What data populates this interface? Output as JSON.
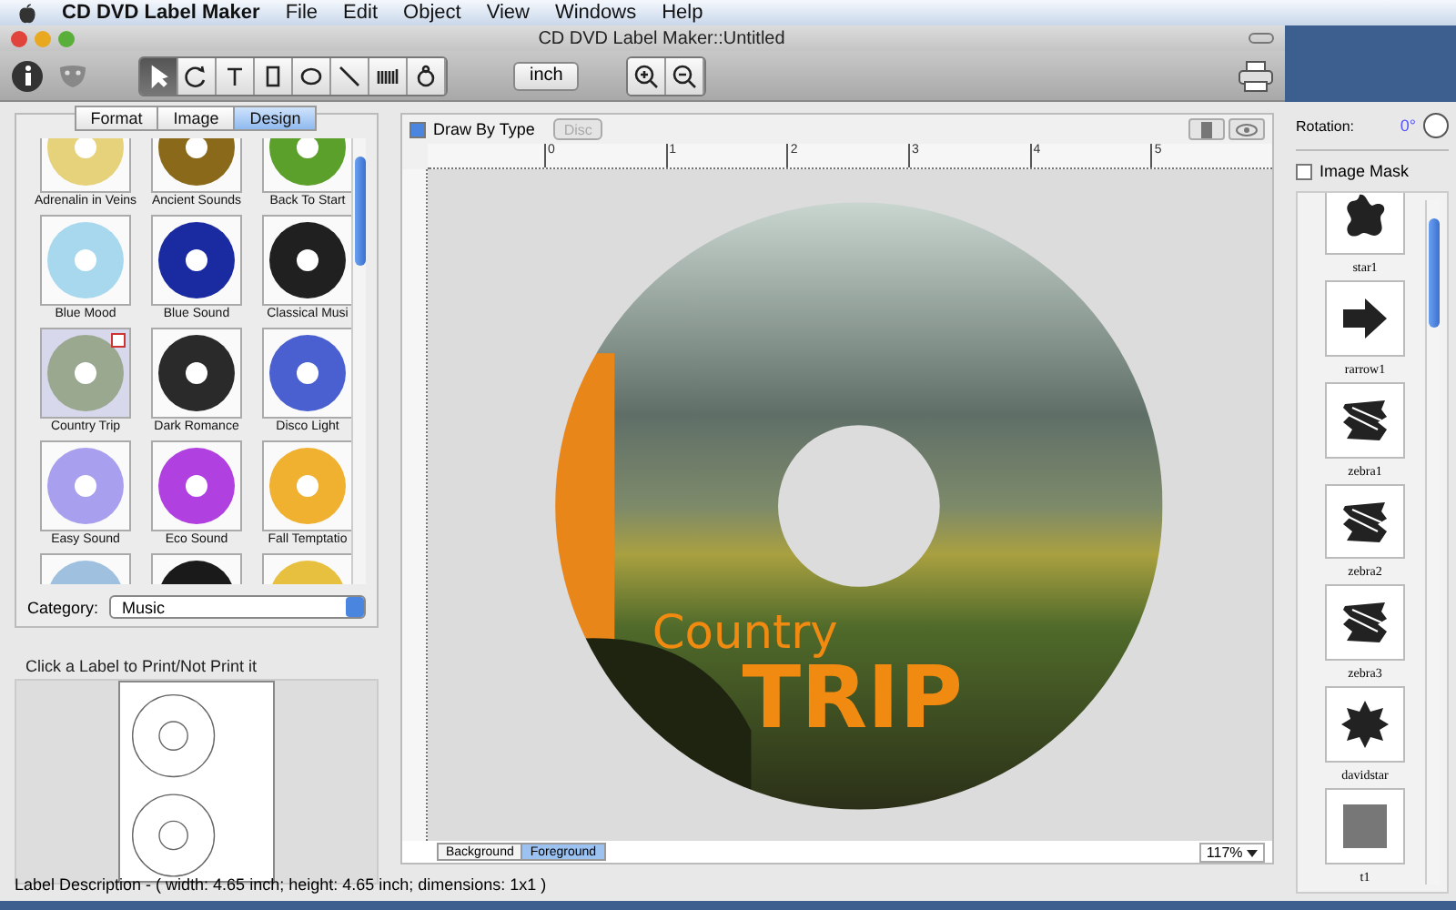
{
  "menu_bar": {
    "items": [
      {
        "label": "CD DVD Label Maker",
        "kind": "app"
      },
      {
        "label": "File",
        "kind": "menu"
      },
      {
        "label": "Edit",
        "kind": "menu"
      },
      {
        "label": "Object",
        "kind": "menu"
      },
      {
        "label": "View",
        "kind": "menu"
      },
      {
        "label": "Windows",
        "kind": "menu"
      },
      {
        "label": "Help",
        "kind": "menu"
      }
    ]
  },
  "window": {
    "title": "CD DVD Label Maker::Untitled"
  },
  "toolbar": {
    "tools": [
      {
        "kind": "pointer",
        "selected": true
      },
      {
        "kind": "rotate",
        "selected": false
      },
      {
        "kind": "text",
        "selected": false
      },
      {
        "kind": "rectangle",
        "selected": false
      },
      {
        "kind": "ellipse",
        "selected": false
      },
      {
        "kind": "line",
        "selected": false
      },
      {
        "kind": "barcode",
        "selected": false
      },
      {
        "kind": "stamp",
        "selected": false
      }
    ],
    "unit": "inch"
  },
  "left_panel": {
    "tabs": [
      {
        "label": "Format",
        "selected": false
      },
      {
        "label": "Image",
        "selected": false
      },
      {
        "label": "Design",
        "selected": true
      }
    ],
    "designs": [
      {
        "name": "Adrenalin in Veins",
        "color": "#e6d27a",
        "selected": false
      },
      {
        "name": "Ancient Sounds",
        "color": "#8a6a1a",
        "selected": false
      },
      {
        "name": "Back To Start",
        "color": "#5aa02a",
        "selected": false
      },
      {
        "name": "Blue Mood",
        "color": "#a8d8ee",
        "selected": false
      },
      {
        "name": "Blue Sound",
        "color": "#1a2aa0",
        "selected": false
      },
      {
        "name": "Classical Musi",
        "color": "#202020",
        "selected": false
      },
      {
        "name": "Country Trip",
        "color": "#9aa890",
        "selected": true
      },
      {
        "name": "Dark Romance",
        "color": "#2a2a2a",
        "selected": false
      },
      {
        "name": "Disco Light",
        "color": "#4a60d0",
        "selected": false
      },
      {
        "name": "Easy Sound",
        "color": "#a8a0ee",
        "selected": false
      },
      {
        "name": "Eco Sound",
        "color": "#b040e0",
        "selected": false
      },
      {
        "name": "Fall Temptatio",
        "color": "#f0b030",
        "selected": false
      },
      {
        "color": "#a0c0e0",
        "selected": false
      },
      {
        "color": "#1a1a1a",
        "selected": false
      },
      {
        "color": "#e8c040",
        "selected": false
      }
    ],
    "category_label": "Category:",
    "category": "Music",
    "hint": "Click a Label to Print/Not Print it"
  },
  "canvas": {
    "draw_by_type": {
      "label": "Draw By Type",
      "checked": true
    },
    "disc_button": {
      "label": "Disc",
      "disabled": true
    },
    "ruler": [
      "0",
      "1",
      "2",
      "3",
      "4",
      "5"
    ],
    "label_text": [
      "Country",
      "TRIP"
    ],
    "layers": [
      {
        "label": "Background",
        "selected": false
      },
      {
        "label": "Foreground",
        "selected": true
      }
    ],
    "zoom": "117%"
  },
  "right_panel": {
    "rotation_label": "Rotation:",
    "rotation": "0°",
    "image_mask": {
      "label": "Image Mask",
      "checked": false
    },
    "shapes": [
      {
        "name": "star1",
        "kind": "blob"
      },
      {
        "name": "rarrow1",
        "kind": "arrow"
      },
      {
        "name": "zebra1",
        "kind": "zebra"
      },
      {
        "name": "zebra2",
        "kind": "zebra"
      },
      {
        "name": "zebra3",
        "kind": "zebra"
      },
      {
        "name": "davidstar",
        "kind": "star"
      },
      {
        "name": "t1",
        "kind": "square"
      }
    ]
  },
  "status_bar": "Label Description - ( width: 4.65 inch; height: 4.65 inch; dimensions: 1x1 )"
}
